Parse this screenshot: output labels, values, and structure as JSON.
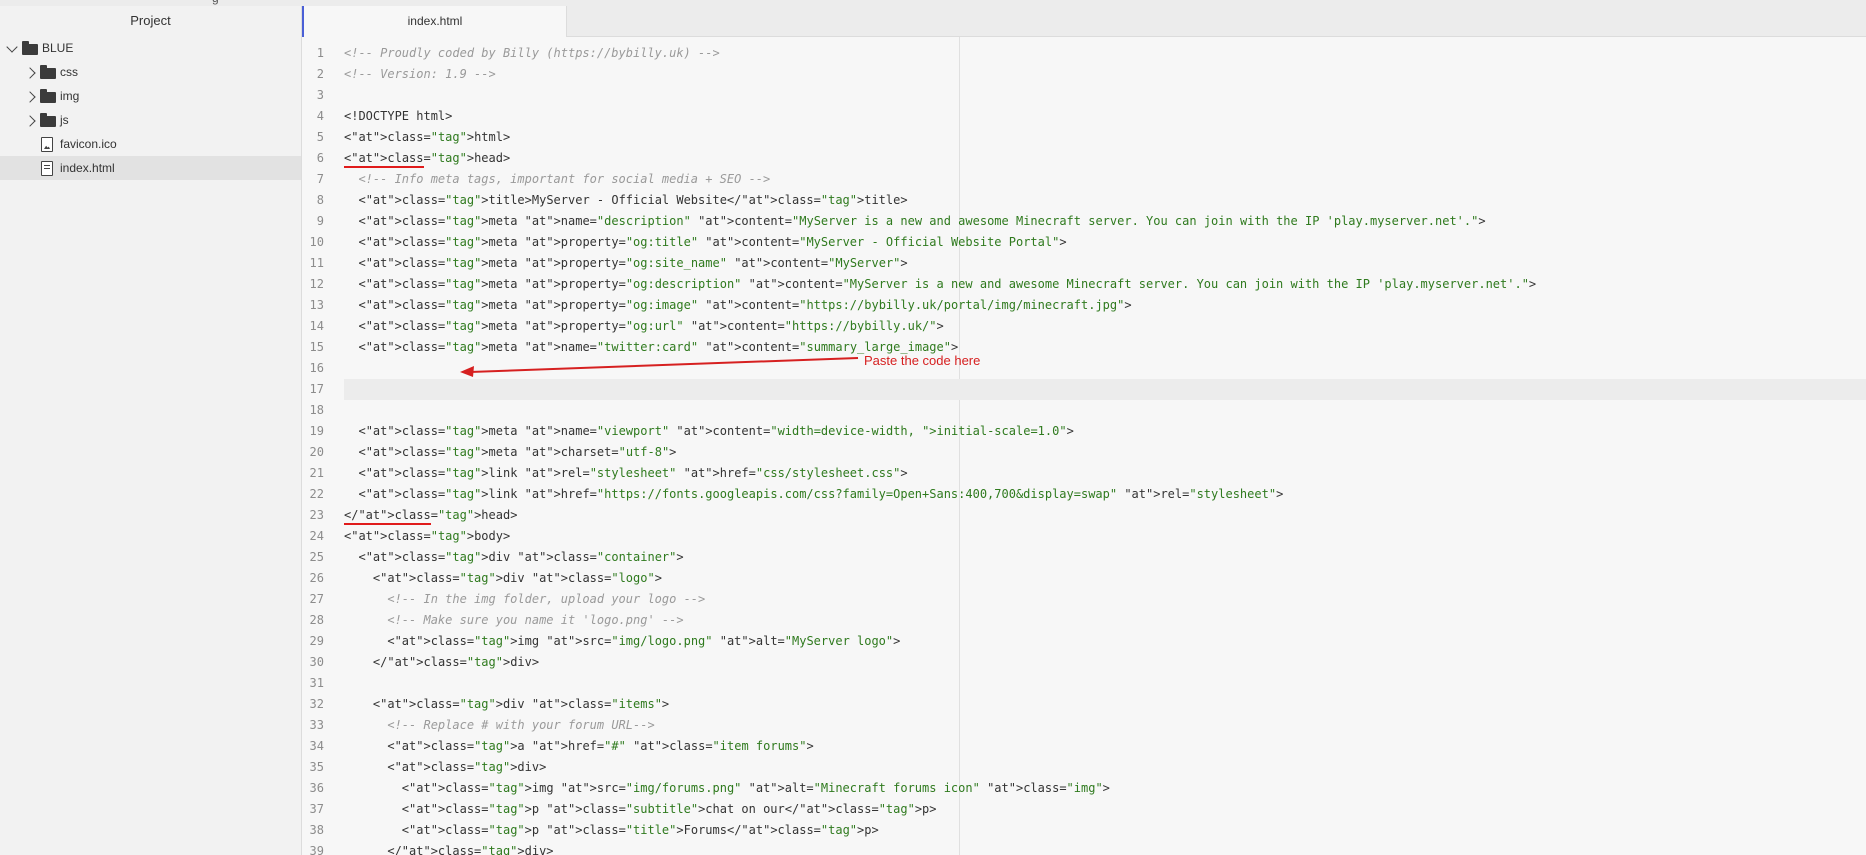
{
  "sidebar": {
    "title": "Project",
    "tree": [
      {
        "label": "BLUE",
        "type": "folder",
        "expanded": true,
        "icon": "folder-icon",
        "depth": 0
      },
      {
        "label": "css",
        "type": "folder",
        "expanded": false,
        "icon": "folder-icon",
        "depth": 1
      },
      {
        "label": "img",
        "type": "folder",
        "expanded": false,
        "icon": "folder-icon",
        "depth": 1
      },
      {
        "label": "js",
        "type": "folder",
        "expanded": false,
        "icon": "folder-icon",
        "depth": 1
      },
      {
        "label": "favicon.ico",
        "type": "file",
        "icon": "image-file-icon",
        "depth": 1
      },
      {
        "label": "index.html",
        "type": "file",
        "icon": "text-file-icon",
        "depth": 1,
        "selected": true
      }
    ]
  },
  "editor": {
    "tab_label": "index.html",
    "highlighted_line": 17,
    "lines": [
      {
        "n": "1",
        "code": "<!-- Proudly coded by Billy (https://bybilly.uk) -->"
      },
      {
        "n": "2",
        "code": "<!-- Version: 1.9 -->"
      },
      {
        "n": "3",
        "code": ""
      },
      {
        "n": "4",
        "code": "<!DOCTYPE html>"
      },
      {
        "n": "5",
        "code": "<html>"
      },
      {
        "n": "6",
        "code": "<head>"
      },
      {
        "n": "7",
        "code": "  <!-- Info meta tags, important for social media + SEO -->"
      },
      {
        "n": "8",
        "code": "  <title>MyServer - Official Website</title>"
      },
      {
        "n": "9",
        "code": "  <meta name=\"description\" content=\"MyServer is a new and awesome Minecraft server. You can join with the IP 'play.myserver.net'.\">"
      },
      {
        "n": "10",
        "code": "  <meta property=\"og:title\" content=\"MyServer - Official Website Portal\">"
      },
      {
        "n": "11",
        "code": "  <meta property=\"og:site_name\" content=\"MyServer\">"
      },
      {
        "n": "12",
        "code": "  <meta property=\"og:description\" content=\"MyServer is a new and awesome Minecraft server. You can join with the IP 'play.myserver.net'.\">"
      },
      {
        "n": "13",
        "code": "  <meta property=\"og:image\" content=\"https://bybilly.uk/portal/img/minecraft.jpg\">"
      },
      {
        "n": "14",
        "code": "  <meta property=\"og:url\" content=\"https://bybilly.uk/\">"
      },
      {
        "n": "15",
        "code": "  <meta name=\"twitter:card\" content=\"summary_large_image\">"
      },
      {
        "n": "16",
        "code": ""
      },
      {
        "n": "17",
        "code": ""
      },
      {
        "n": "18",
        "code": ""
      },
      {
        "n": "19",
        "code": "  <meta name=\"viewport\" content=\"width=device-width, initial-scale=1.0\">"
      },
      {
        "n": "20",
        "code": "  <meta charset=\"utf-8\">"
      },
      {
        "n": "21",
        "code": "  <link rel=\"stylesheet\" href=\"css/stylesheet.css\">"
      },
      {
        "n": "22",
        "code": "  <link href=\"https://fonts.googleapis.com/css?family=Open+Sans:400,700&display=swap\" rel=\"stylesheet\">"
      },
      {
        "n": "23",
        "code": "</head>"
      },
      {
        "n": "24",
        "code": "<body>"
      },
      {
        "n": "25",
        "code": "  <div class=\"container\">"
      },
      {
        "n": "26",
        "code": "    <div class=\"logo\">"
      },
      {
        "n": "27",
        "code": "      <!-- In the img folder, upload your logo -->"
      },
      {
        "n": "28",
        "code": "      <!-- Make sure you name it 'logo.png' -->"
      },
      {
        "n": "29",
        "code": "      <img src=\"img/logo.png\" alt=\"MyServer logo\">"
      },
      {
        "n": "30",
        "code": "    </div>"
      },
      {
        "n": "31",
        "code": ""
      },
      {
        "n": "32",
        "code": "    <div class=\"items\">"
      },
      {
        "n": "33",
        "code": "      <!-- Replace # with your forum URL-->"
      },
      {
        "n": "34",
        "code": "      <a href=\"#\" class=\"item forums\">"
      },
      {
        "n": "35",
        "code": "      <div>"
      },
      {
        "n": "36",
        "code": "        <img src=\"img/forums.png\" alt=\"Minecraft forums icon\" class=\"img\">"
      },
      {
        "n": "37",
        "code": "        <p class=\"subtitle\">chat on our</p>"
      },
      {
        "n": "38",
        "code": "        <p class=\"title\">Forums</p>"
      },
      {
        "n": "39",
        "code": "      </div>"
      }
    ]
  },
  "annotation": {
    "text": "Paste the code here",
    "color": "#d62020",
    "points_to_line": 17
  },
  "underlined_lines": [
    "6",
    "23"
  ],
  "colors": {
    "tab_accent": "#4a5fd6",
    "tag": "#c23b22",
    "attribute": "#6c3a00",
    "string": "#2f7a1e",
    "comment": "#9a9a9a"
  }
}
